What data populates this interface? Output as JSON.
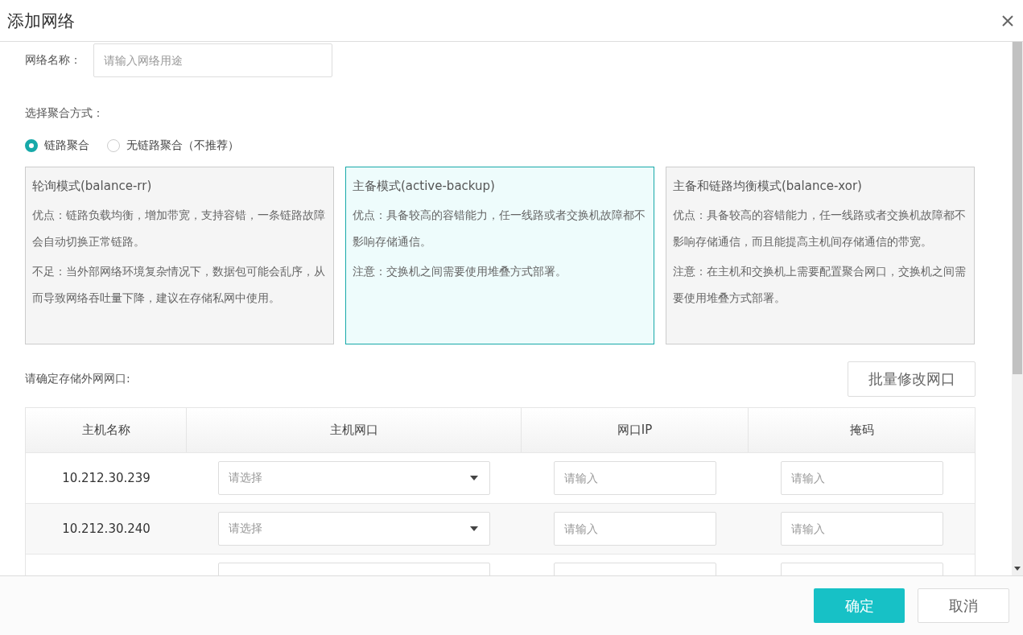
{
  "dialog": {
    "title": "添加网络"
  },
  "name_field": {
    "label": "网络名称：",
    "placeholder": "请输入网络用途"
  },
  "mode_label": "选择聚合方式：",
  "radios": [
    {
      "label": "链路聚合",
      "selected": true
    },
    {
      "label": "无链路聚合（不推荐）",
      "selected": false
    }
  ],
  "modes": [
    {
      "title": "轮询模式(balance-rr)",
      "selected": false,
      "paragraphs": [
        "优点：链路负载均衡，增加带宽，支持容错，一条链路故障会自动切换正常链路。",
        "不足：当外部网络环境复杂情况下，数据包可能会乱序，从而导致网络吞吐量下降，建议在存储私网中使用。"
      ]
    },
    {
      "title": "主备模式(active-backup)",
      "selected": true,
      "paragraphs": [
        "优点：具备较高的容错能力，任一线路或者交换机故障都不影响存储通信。",
        "注意：交换机之间需要使用堆叠方式部署。"
      ]
    },
    {
      "title": "主备和链路均衡模式(balance-xor)",
      "selected": false,
      "paragraphs": [
        "优点：具备较高的容错能力，任一线路或者交换机故障都不影响存储通信，而且能提高主机间存储通信的带宽。",
        "注意：在主机和交换机上需要配置聚合网口，交换机之间需要使用堆叠方式部署。"
      ]
    }
  ],
  "ports_label": "请确定存储外网网口:",
  "batch_button": "批量修改网口",
  "table": {
    "columns": [
      "主机名称",
      "主机网口",
      "网口IP",
      "掩码"
    ],
    "rows": [
      {
        "host": "10.212.30.239",
        "port_placeholder": "请选择",
        "ip_placeholder": "请输入",
        "mask_placeholder": "请输入"
      },
      {
        "host": "10.212.30.240",
        "port_placeholder": "请选择",
        "ip_placeholder": "请输入",
        "mask_placeholder": "请输入"
      },
      {}
    ]
  },
  "footer_buttons": [
    {
      "label": "确定",
      "kind": "primary"
    },
    {
      "label": "取消",
      "kind": "default"
    }
  ]
}
